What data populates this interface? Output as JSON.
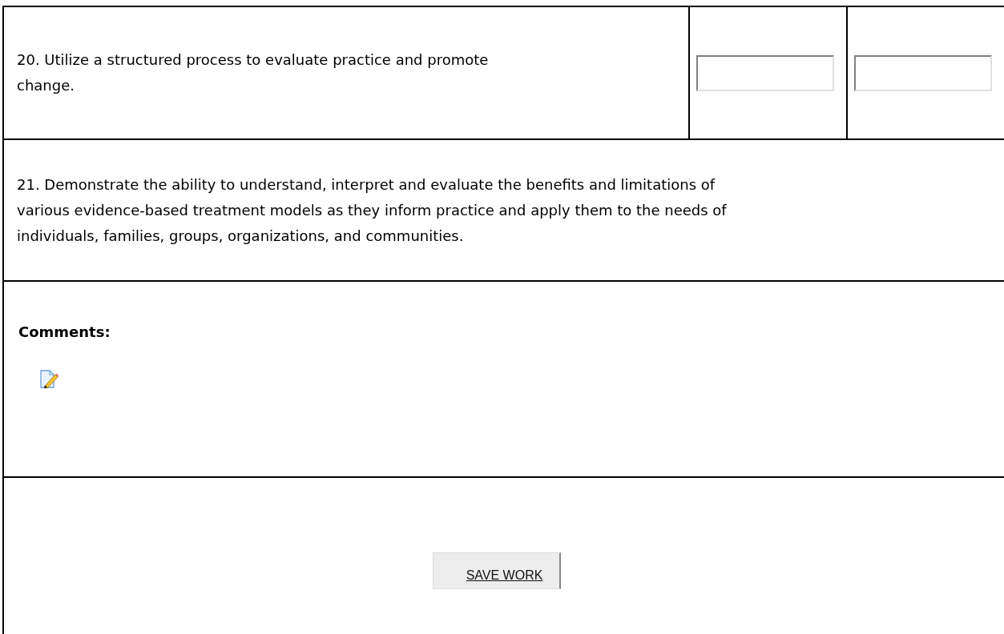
{
  "items": [
    {
      "text": "20. Utilize a structured process to evaluate practice and promote change.",
      "kind": "rated",
      "fields": [
        {
          "kind": "text"
        },
        {
          "kind": "text"
        }
      ]
    },
    {
      "text": "21. Demonstrate the ability to understand, interpret and evaluate the benefits and limitations of various evidence-based treatment models as they inform practice and apply them to the needs of individuals, families, groups, organizations, and communities.",
      "kind": "plain"
    }
  ],
  "comments": {
    "label": "Comments:"
  },
  "save_button": {
    "label": "SAVE WORK"
  }
}
